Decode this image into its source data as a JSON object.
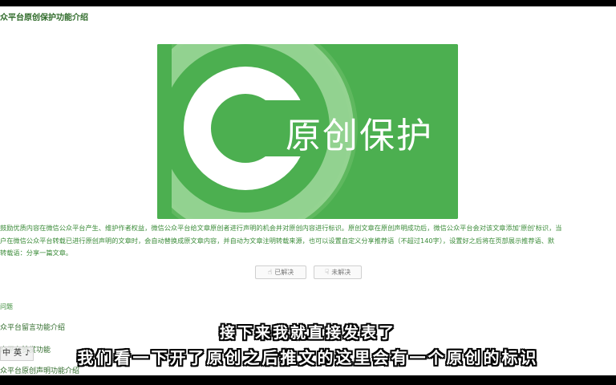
{
  "article": {
    "title": "众平台原创保护功能介绍",
    "banner_text": "原创保护",
    "paragraph_lines": [
      "鼓励优质内容在微信公众平台产生、维护作者权益，微信公众平台给文章原创者进行声明的机会并对原创内容进行标识。原创文章在原创声明成功后，微信公众平台会对该文章添加'原创'标识，当",
      "户在微信公众平台转载已进行原创声明的文章时，会自动替换成原文章内容，并自动为文章注明转载来源，也可以设置自定义分享推荐语（不超过140字），设置好之后将在页部展示推荐语、默",
      "转载语：分享一篇文章。"
    ],
    "feedback": {
      "solved_label": "已解决",
      "unsolved_label": "未解决",
      "solved_icon": "thumbs-up-icon",
      "unsolved_icon": "thumbs-down-icon"
    }
  },
  "related": {
    "heading": "问题",
    "items": [
      "众平台留言功能介绍",
      "众平台赞赏功能",
      "众平台原创声明功能介绍"
    ]
  },
  "ime_toolbar": {
    "items": [
      "中",
      "英",
      "♪"
    ]
  },
  "subtitles": {
    "line1": "接下来我就直接发表了",
    "line2": "我们看一下开了原创之后推文的这里会有一个原创的标识"
  },
  "colors": {
    "banner_green": "#4caf50",
    "banner_light_green": "#8fd18c",
    "text_green": "#3c8c3a",
    "subtitle_white": "#ffffff"
  }
}
